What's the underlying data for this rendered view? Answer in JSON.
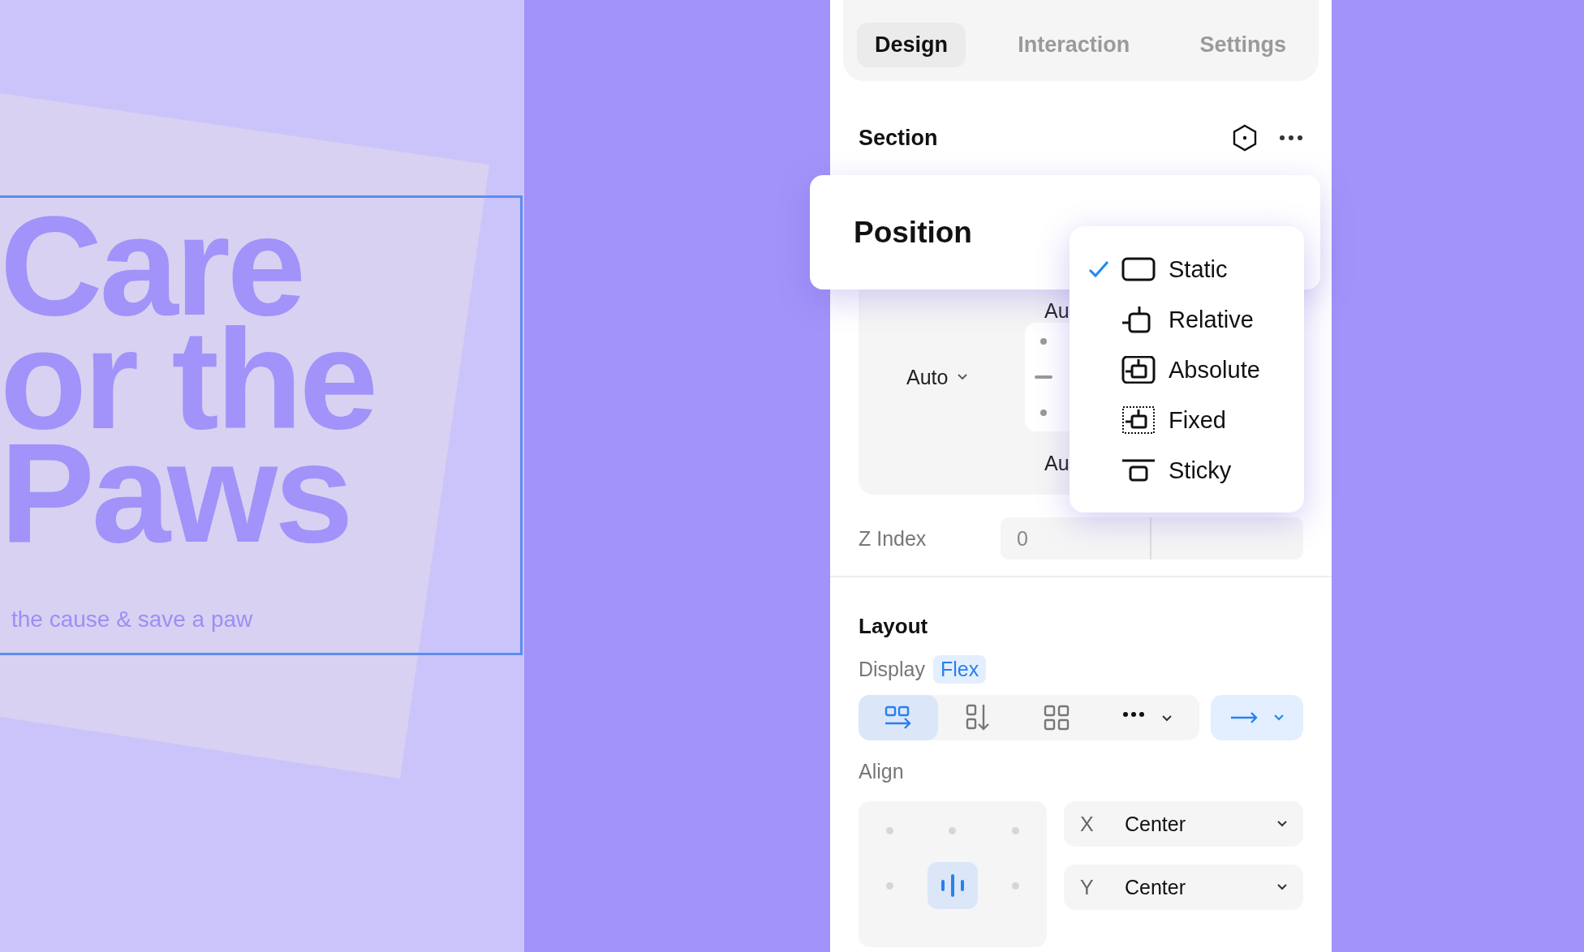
{
  "canvas": {
    "selected": true,
    "headline_lines": [
      "Care",
      "or the",
      "Paws"
    ],
    "tagline": "the cause & save a paw"
  },
  "panel": {
    "tabs": [
      {
        "label": "Design",
        "selected": true
      },
      {
        "label": "Interaction",
        "selected": false
      },
      {
        "label": "Settings",
        "selected": false
      }
    ],
    "section": {
      "title": "Section"
    },
    "position": {
      "title": "Position",
      "menu": [
        {
          "label": "Static",
          "kind": "static",
          "selected": true
        },
        {
          "label": "Relative",
          "kind": "relative",
          "selected": false
        },
        {
          "label": "Absolute",
          "kind": "absolute",
          "selected": false
        },
        {
          "label": "Fixed",
          "kind": "fixed",
          "selected": false
        },
        {
          "label": "Sticky",
          "kind": "sticky",
          "selected": false
        }
      ]
    },
    "spacing": {
      "top": "Au",
      "left": "Auto",
      "bottom": "Au"
    },
    "z_index": {
      "label": "Z Index",
      "placeholder": "0"
    },
    "layout": {
      "title": "Layout",
      "display_label": "Display",
      "display_value": "Flex",
      "modes": [
        {
          "kind": "row",
          "selected": true
        },
        {
          "kind": "column",
          "selected": false
        },
        {
          "kind": "grid",
          "selected": false
        },
        {
          "kind": "more",
          "selected": false
        }
      ],
      "align_label": "Align",
      "align_cells": [
        {
          "selected": false
        },
        {
          "selected": false
        },
        {
          "selected": false
        },
        {
          "selected": false
        },
        {
          "selected": true
        },
        {
          "selected": false
        }
      ],
      "align_x": {
        "axis": "X",
        "value": "Center"
      },
      "align_y": {
        "axis": "Y",
        "value": "Center"
      }
    }
  }
}
